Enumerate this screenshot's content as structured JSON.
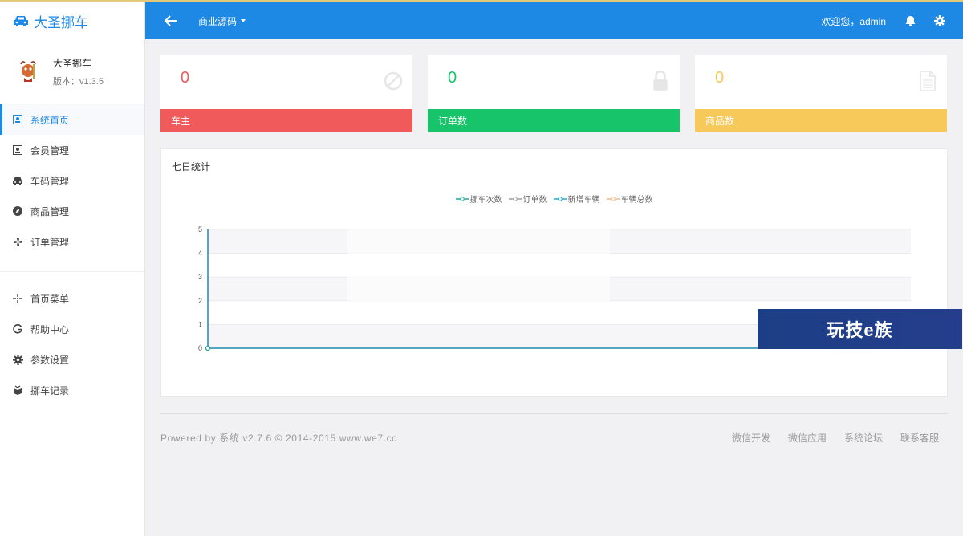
{
  "app": {
    "title": "大圣挪车"
  },
  "profile": {
    "name": "大圣挪车",
    "version": "版本：v1.3.5"
  },
  "sidebar": {
    "items": [
      {
        "label": "系统首页",
        "icon": "home-icon",
        "active": true
      },
      {
        "label": "会员管理",
        "icon": "member-icon"
      },
      {
        "label": "车码管理",
        "icon": "car-icon"
      },
      {
        "label": "商品管理",
        "icon": "compass-icon"
      },
      {
        "label": "订单管理",
        "icon": "fan-icon"
      }
    ],
    "items2": [
      {
        "label": "首页菜单",
        "icon": "crosshair-icon"
      },
      {
        "label": "帮助中心",
        "icon": "google-icon"
      },
      {
        "label": "参数设置",
        "icon": "gear-icon"
      },
      {
        "label": "挪车记录",
        "icon": "box-icon"
      }
    ]
  },
  "header": {
    "dropdown": "商业源码",
    "welcome": "欢迎您，admin"
  },
  "cards": [
    {
      "value": "0",
      "label": "车主",
      "color": "#f05a5a",
      "icon": "ban-icon"
    },
    {
      "value": "0",
      "label": "订单数",
      "color": "#18c46a",
      "icon": "lock-icon"
    },
    {
      "value": "0",
      "label": "商品数",
      "color": "#f7c85a",
      "icon": "document-icon"
    }
  ],
  "panel": {
    "title": "七日统计"
  },
  "chart_data": {
    "type": "line",
    "series": [
      {
        "name": "挪车次数",
        "color": "#26a69a"
      },
      {
        "name": "订单数",
        "color": "#9e9e9e"
      },
      {
        "name": "新增车辆",
        "color": "#26a6c8"
      },
      {
        "name": "车辆总数",
        "color": "#f0b98a"
      }
    ],
    "y_ticks": [
      "0",
      "1",
      "2",
      "3",
      "4",
      "5"
    ],
    "ylim": [
      0,
      5
    ]
  },
  "watermark": "玩技e族",
  "footer": {
    "left": "Powered by 系统 v2.7.6 © 2014-2015 www.we7.cc",
    "links": [
      "微信开发",
      "微信应用",
      "系统论坛",
      "联系客服"
    ]
  }
}
